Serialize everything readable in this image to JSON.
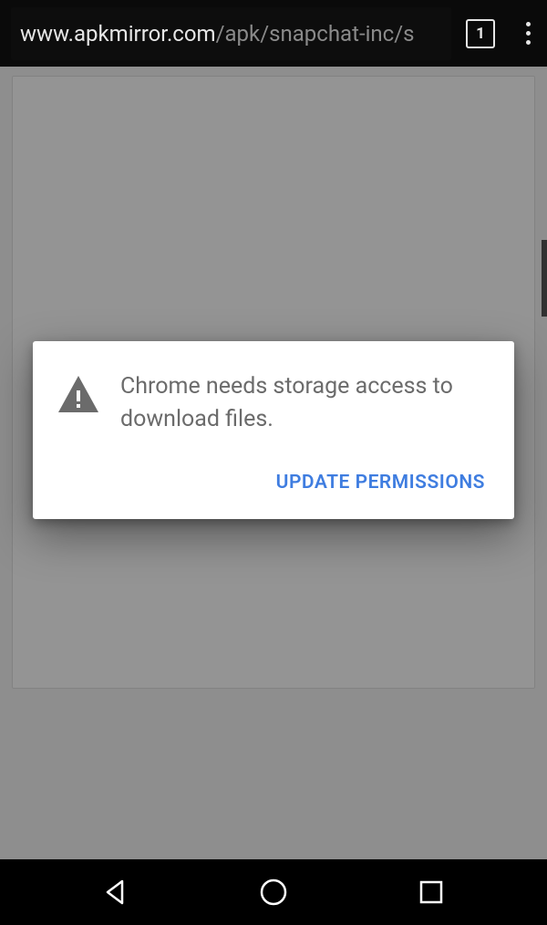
{
  "browser": {
    "url_domain": "www.apkmirror.com",
    "url_path": "/apk/snapchat-inc/s",
    "tab_count": "1"
  },
  "dialog": {
    "message": "Chrome needs storage access to download files.",
    "action_label": "UPDATE PERMISSIONS"
  }
}
